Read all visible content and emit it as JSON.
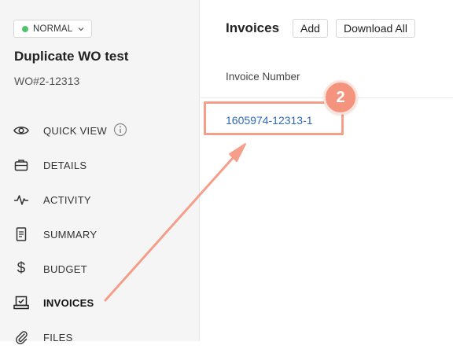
{
  "status": {
    "label": "NORMAL",
    "color": "#52c46b"
  },
  "work_order": {
    "title": "Duplicate WO test",
    "number": "WO#2-12313"
  },
  "nav": [
    {
      "label": "QUICK VIEW",
      "icon": "eye-icon"
    },
    {
      "label": "DETAILS",
      "icon": "briefcase-icon"
    },
    {
      "label": "ACTIVITY",
      "icon": "pulse-icon"
    },
    {
      "label": "SUMMARY",
      "icon": "document-icon"
    },
    {
      "label": "BUDGET",
      "icon": "dollar-icon"
    },
    {
      "label": "INVOICES",
      "icon": "invoice-tray-icon",
      "active": true
    },
    {
      "label": "FILES",
      "icon": "paperclip-icon"
    }
  ],
  "invoices": {
    "title": "Invoices",
    "add_label": "Add",
    "download_all_label": "Download All",
    "column_header": "Invoice Number",
    "rows": [
      {
        "number": "1605974-12313-1"
      }
    ]
  },
  "annotation": {
    "step": "2",
    "color": "#f4947e"
  }
}
